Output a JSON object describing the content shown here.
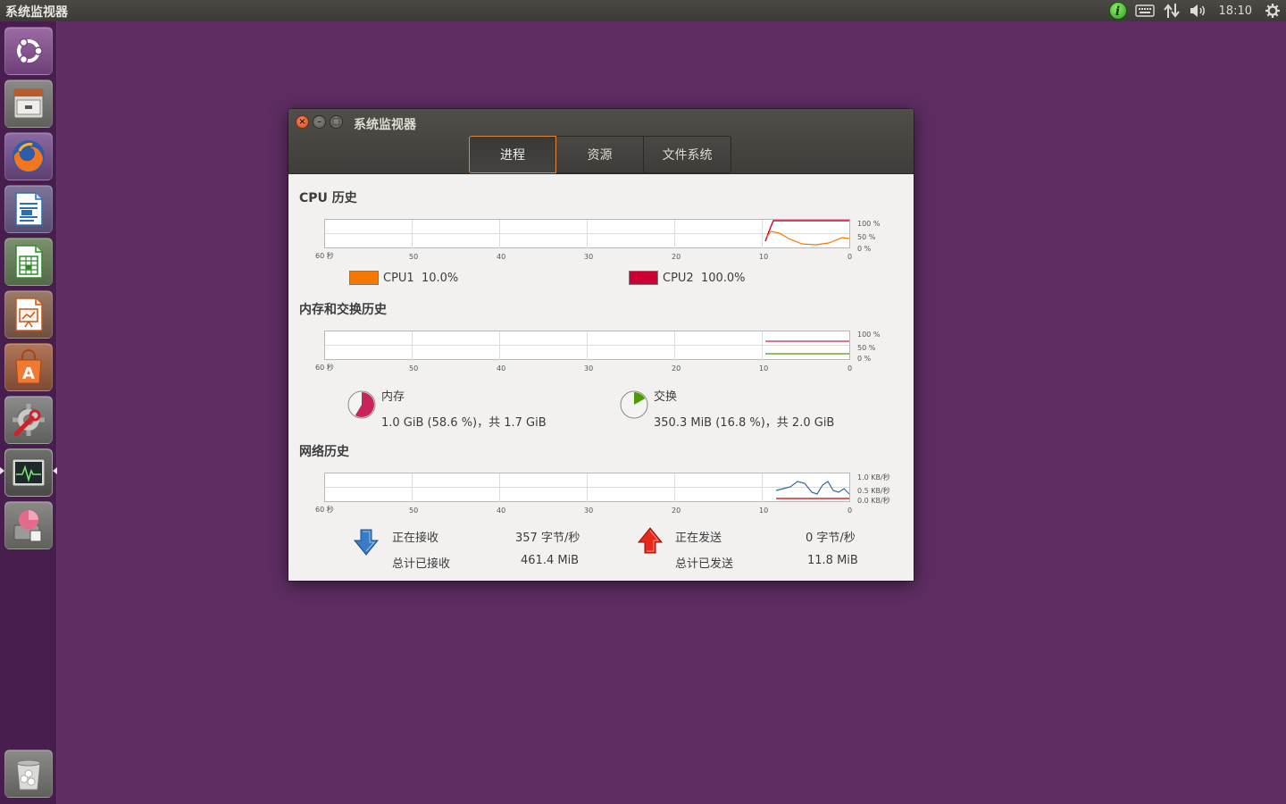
{
  "topbar": {
    "app_title": "系统监视器",
    "clock": "18:10",
    "info_glyph": "i",
    "icons": [
      "info-icon",
      "keyboard-icon",
      "network-icon",
      "volume-icon",
      "gear-icon"
    ]
  },
  "launcher": {
    "items": [
      "ubuntu-dash",
      "files",
      "firefox",
      "libreoffice-writer",
      "libreoffice-calc",
      "libreoffice-impress",
      "ubuntu-software",
      "system-settings",
      "system-monitor",
      "disk-usage",
      "trash"
    ]
  },
  "window": {
    "title": "系统监视器",
    "close_glyph": "×",
    "min_glyph": "–",
    "max_glyph": "□",
    "tabs": [
      {
        "label": "进程",
        "active": true
      },
      {
        "label": "资源",
        "active": false
      },
      {
        "label": "文件系统",
        "active": false
      }
    ]
  },
  "cpu": {
    "title": "CPU 历史",
    "x_ticks": [
      "60 秒",
      "50",
      "40",
      "30",
      "20",
      "10",
      "0"
    ],
    "y_ticks": [
      "100 %",
      "50 %",
      "0 %"
    ],
    "legend": [
      {
        "label": "CPU1  10.0%",
        "color": "#f57900"
      },
      {
        "label": "CPU2  100.0%",
        "color": "#cc0033"
      }
    ]
  },
  "memory": {
    "title": "内存和交换历史",
    "x_ticks": [
      "60 秒",
      "50",
      "40",
      "30",
      "20",
      "10",
      "0"
    ],
    "y_ticks": [
      "100 %",
      "50 %",
      "0 %"
    ],
    "mem_label": "内存",
    "mem_value": "1.0 GiB (58.6 %)，共 1.7 GiB",
    "mem_percent": 58.6,
    "mem_color": "#c7245c",
    "swap_label": "交换",
    "swap_value": "350.3 MiB (16.8 %)，共 2.0 GiB",
    "swap_percent": 16.8,
    "swap_color": "#4e9a06"
  },
  "network": {
    "title": "网络历史",
    "x_ticks": [
      "60 秒",
      "50",
      "40",
      "30",
      "20",
      "10",
      "0"
    ],
    "y_ticks": [
      "1.0 KB/秒",
      "0.5 KB/秒",
      "0.0 KB/秒"
    ],
    "receiving_label": "正在接收",
    "receiving_value": "357 字节/秒",
    "total_received_label": "总计已接收",
    "total_received_value": "461.4 MiB",
    "sending_label": "正在发送",
    "sending_value": "0 字节/秒",
    "total_sent_label": "总计已发送",
    "total_sent_value": "11.8 MiB",
    "recv_color": "#3465a4",
    "send_color": "#cc0000"
  }
}
